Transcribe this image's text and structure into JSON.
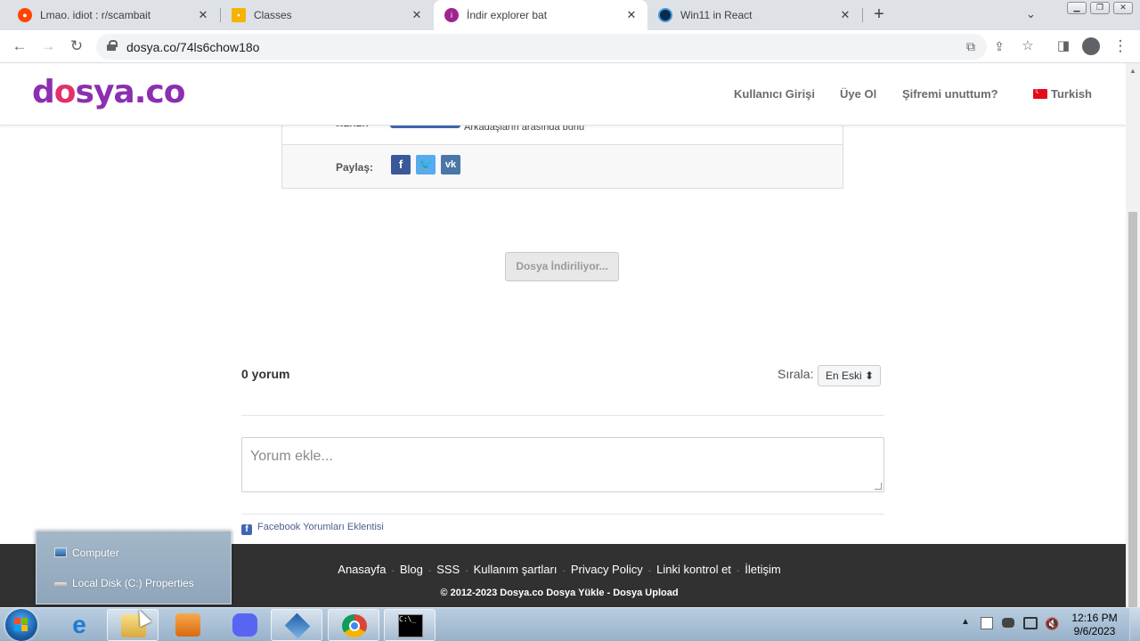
{
  "browser": {
    "tabs": [
      {
        "title": "Lmao. idiot : r/scambait",
        "favicon": "reddit-icon",
        "active": false
      },
      {
        "title": "Classes",
        "favicon": "classroom-icon",
        "active": false
      },
      {
        "title": "İndir explorer bat",
        "favicon": "dosya-icon",
        "active": true
      },
      {
        "title": "Win11 in React",
        "favicon": "win11-icon",
        "active": false
      }
    ],
    "new_tab": "+",
    "url": "dosya.co/74ls6chow18o"
  },
  "site": {
    "logo": {
      "left": "d",
      "o": "o",
      "right": "sya.co"
    },
    "nav": {
      "login": "Kullanıcı Girişi",
      "signup": "Üye Ol",
      "forgot": "Şifremi unuttum?",
      "language": "Turkish"
    },
    "share_label": "Paylaş:",
    "friends_text": "Arkadaşların arasında bunu",
    "cut_label": "Beğen:",
    "download_button": "Dosya İndiriliyor...",
    "comments": {
      "count": "0 yorum",
      "sort_label": "Sırala:",
      "sort_value": "En Eski ⬍",
      "placeholder": "Yorum ekle...",
      "plugin": "Facebook Yorumları Eklentisi"
    },
    "footer": {
      "links": [
        "Anasayfa",
        "Blog",
        "SSS",
        "Kullanım şartları",
        "Privacy Policy",
        "Linki kontrol et",
        "İletişim"
      ],
      "copyright": "© 2012-2023 Dosya.co Dosya Yükle - Dosya Upload"
    }
  },
  "jumplist": {
    "items": [
      "Computer",
      "Local Disk (C:) Properties"
    ]
  },
  "taskbar": {
    "apps": [
      "internet-explorer-icon",
      "windows-explorer-icon",
      "media-player-icon",
      "discord-icon",
      "virtualbox-icon",
      "chrome-icon",
      "cmd-icon"
    ],
    "time": "12:16 PM",
    "date": "9/6/2023"
  },
  "colors": {
    "logo_purple": "#8b2fb0",
    "logo_pink": "#e3306b",
    "facebook": "#3b5998",
    "twitter": "#55acee",
    "vk": "#4a76a8",
    "footer_bg": "#313131"
  }
}
